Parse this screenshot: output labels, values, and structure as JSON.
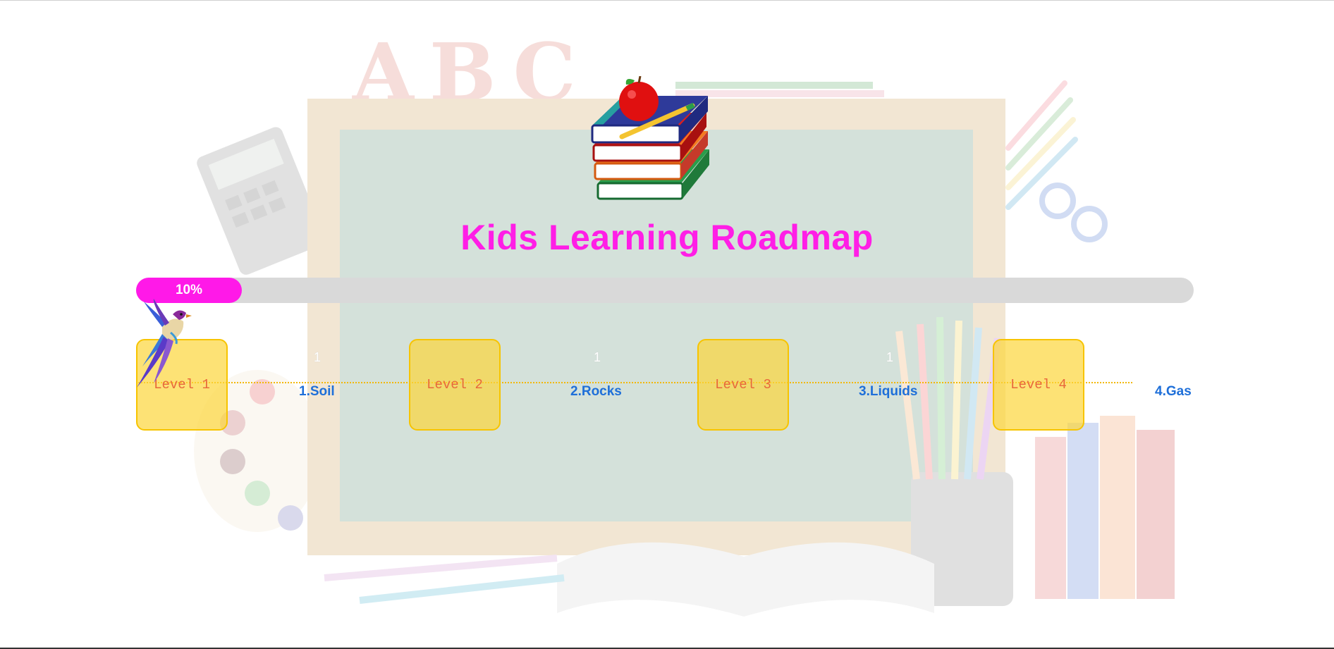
{
  "page": {
    "title": "Kids Learning Roadmap"
  },
  "progress": {
    "percent": 10,
    "label": "10%"
  },
  "levels": [
    {
      "label": "Level 1"
    },
    {
      "label": "Level 2"
    },
    {
      "label": "Level 3"
    },
    {
      "label": "Level 4"
    }
  ],
  "steps": [
    {
      "label": "1.Soil",
      "count": "1"
    },
    {
      "label": "2.Rocks",
      "count": "1"
    },
    {
      "label": "3.Liquids",
      "count": "1"
    },
    {
      "label": "4.Gas",
      "count": ""
    }
  ],
  "background": {
    "decor_text": "ABC"
  },
  "icons": {
    "hero": "books-apple-pencil-icon",
    "marker": "bird-icon"
  },
  "colors": {
    "title": "#ff1ee6",
    "progress_fill": "#ff19e8",
    "progress_track": "#d9d9d9",
    "level_box": "#fcd63a",
    "level_text": "#e8673b",
    "step_text": "#1e6fd9",
    "path_line": "#f3b800"
  }
}
